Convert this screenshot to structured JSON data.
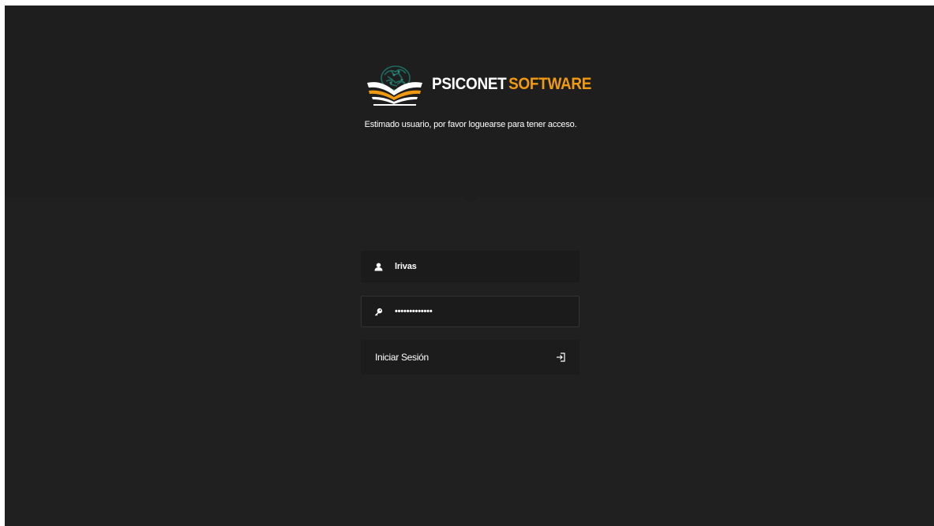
{
  "brand": {
    "name_part1": "PSICONET",
    "name_part2": "SOFTWARE",
    "accent_color": "#f09a12"
  },
  "subtitle": "Estimado usuario, por favor loguearse para tener acceso.",
  "form": {
    "username": {
      "value": "lrivas",
      "icon": "user-icon"
    },
    "password": {
      "value": "*************",
      "icon": "key-icon"
    },
    "submit": {
      "label": "Iniciar Sesión",
      "icon": "sign-in-icon"
    }
  },
  "colors": {
    "background": "#202020",
    "header": "#1e1e1e",
    "field": "#1b1b1b",
    "text": "#ffffff"
  }
}
